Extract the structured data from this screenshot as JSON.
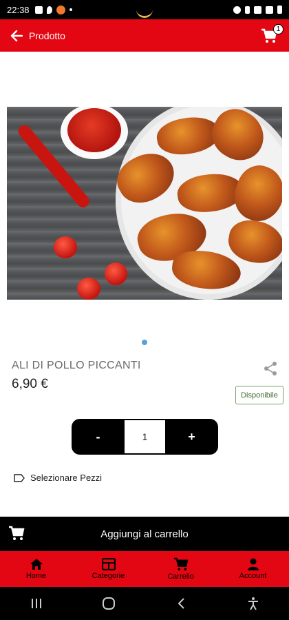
{
  "status_bar": {
    "time": "22:38"
  },
  "app_bar": {
    "title": "Prodotto",
    "cart_count": "1",
    "accent": "#e30613"
  },
  "product": {
    "name": "ALI DI POLLO PICCANTI",
    "price": "6,90 €",
    "availability": "Disponibile",
    "quantity": "1",
    "select_pieces_label": "Selezionare Pezzi"
  },
  "stepper": {
    "minus_label": "-",
    "plus_label": "+"
  },
  "add_to_cart": {
    "label": "Aggiungi al carrello"
  },
  "bottom_nav": {
    "items": [
      {
        "label": "Home",
        "icon": "home-icon"
      },
      {
        "label": "Categorie",
        "icon": "category-icon"
      },
      {
        "label": "Carrello",
        "icon": "cart-icon"
      },
      {
        "label": "Account",
        "icon": "user-icon"
      }
    ]
  },
  "colors": {
    "brand_red": "#e30613",
    "dark": "#000000",
    "dot_active": "#5aa0d8",
    "available_border": "#7aa06a"
  }
}
